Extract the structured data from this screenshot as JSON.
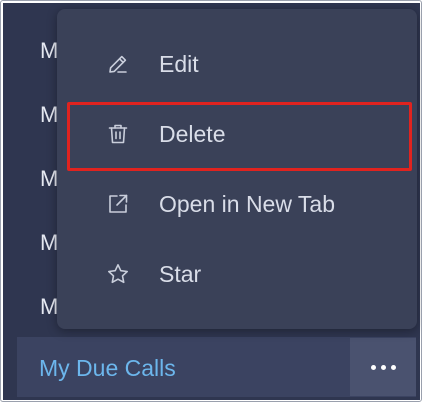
{
  "sidebar": {
    "row_letters": [
      "M",
      "M",
      "M",
      "M",
      "M"
    ]
  },
  "bottom_item": {
    "label": "My Due Calls",
    "more_button_icon": "more-horizontal-icon"
  },
  "context_menu": {
    "items": [
      {
        "label": "Edit",
        "icon": "pencil-icon"
      },
      {
        "label": "Delete",
        "icon": "trash-icon"
      },
      {
        "label": "Open in New Tab",
        "icon": "external-link-icon"
      },
      {
        "label": "Star",
        "icon": "star-icon"
      }
    ],
    "highlighted_item": "Delete",
    "highlight_color": "#e0231f"
  },
  "colors": {
    "sidebar_bg": "#2f3650",
    "menu_bg": "#3a4158",
    "menu_text": "#d9dde8",
    "link_blue": "#6cb6ec"
  }
}
